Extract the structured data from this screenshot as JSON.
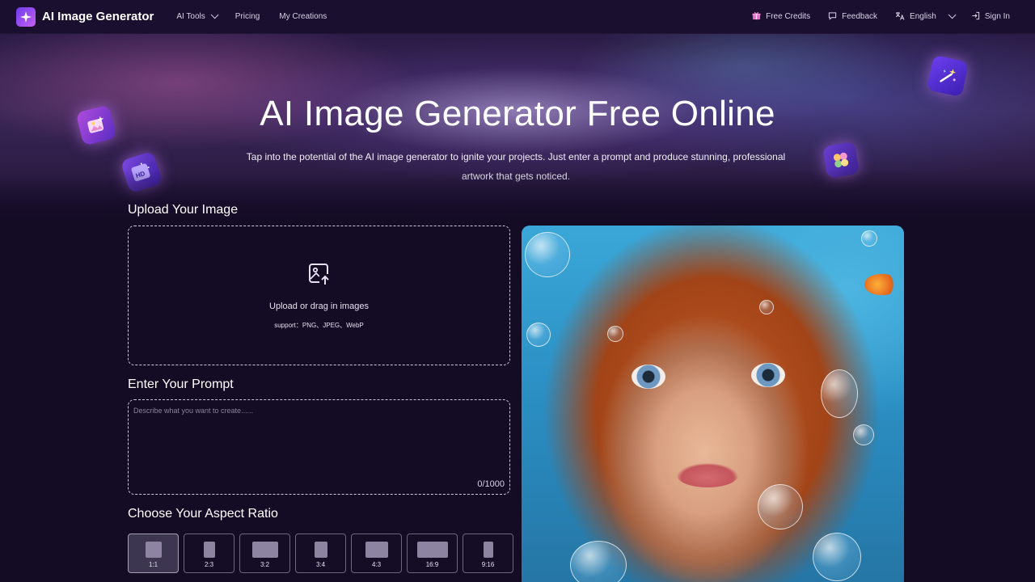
{
  "nav": {
    "brand": "AI Image Generator",
    "links": [
      {
        "label": "AI Tools",
        "has_dropdown": true
      },
      {
        "label": "Pricing"
      },
      {
        "label": "My Creations"
      }
    ],
    "right": [
      {
        "label": "Free Credits",
        "icon": "gift-icon"
      },
      {
        "label": "Feedback",
        "icon": "chat-bubble-icon"
      },
      {
        "label": "English",
        "icon": "translate-icon",
        "has_dropdown": true
      },
      {
        "label": "Sign In",
        "icon": "sign-in-icon"
      }
    ]
  },
  "hero": {
    "title": "AI Image Generator Free Online",
    "subtitle": "Tap into the potential of the AI image generator to ignite your projects. Just enter a prompt and produce stunning, professional artwork that gets noticed."
  },
  "upload": {
    "title": "Upload Your Image",
    "text": "Upload or drag in images",
    "support": "support：PNG、JPEG、WebP"
  },
  "prompt": {
    "title": "Enter Your Prompt",
    "placeholder": "Describe what you want to create......",
    "value": "",
    "count": "0/1000"
  },
  "aspect": {
    "title": "Choose Your Aspect Ratio",
    "selected": "1:1",
    "options": [
      {
        "label": "1:1"
      },
      {
        "label": "2:3"
      },
      {
        "label": "3:2"
      },
      {
        "label": "3:4"
      },
      {
        "label": "4:3"
      },
      {
        "label": "16:9"
      },
      {
        "label": "9:16"
      }
    ]
  },
  "colors": {
    "background": "#140b25",
    "navbar": "#1a0f2e",
    "accent": "#7b4cf0"
  }
}
